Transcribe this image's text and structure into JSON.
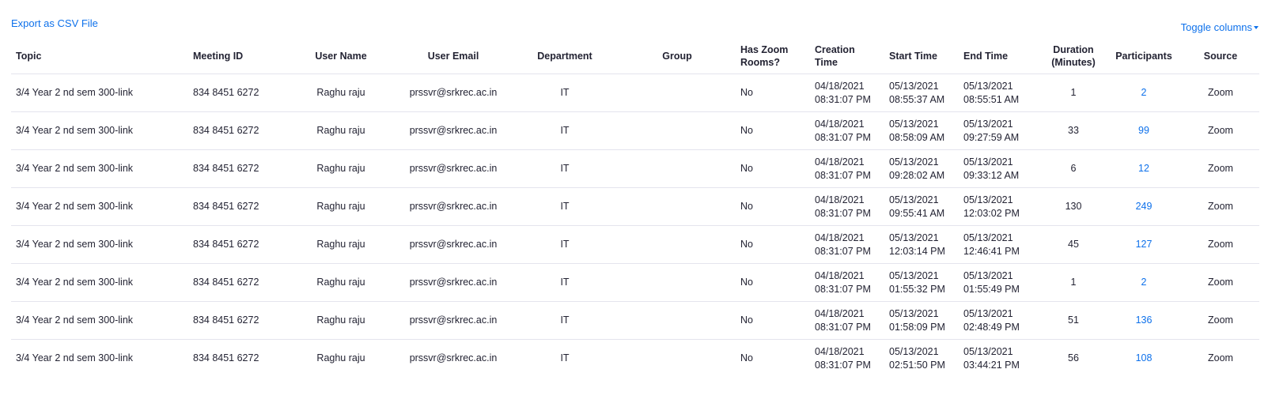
{
  "toolbar": {
    "export_label": "Export as CSV File",
    "toggle_columns_label": "Toggle columns"
  },
  "colors": {
    "link": "#0e71eb",
    "text": "#232333",
    "divider": "#e4e4ed"
  },
  "table": {
    "headers": {
      "topic": "Topic",
      "meeting_id": "Meeting ID",
      "user_name": "User Name",
      "user_email": "User Email",
      "department": "Department",
      "group": "Group",
      "has_zoom_rooms_1": "Has Zoom",
      "has_zoom_rooms_2": "Rooms?",
      "creation_time": "Creation Time",
      "start_time": "Start Time",
      "end_time": "End Time",
      "duration_1": "Duration",
      "duration_2": "(Minutes)",
      "participants": "Participants",
      "source": "Source"
    },
    "rows": [
      {
        "topic": "3/4 Year 2 nd sem 300-link",
        "meeting_id": "834 8451 6272",
        "user_name": "Raghu raju",
        "user_email": "prssvr@srkrec.ac.in",
        "department": "IT",
        "group": "",
        "has_zoom_rooms": "No",
        "creation_date": "04/18/2021",
        "creation_time": "08:31:07 PM",
        "start_date": "05/13/2021",
        "start_time": "08:55:37 AM",
        "end_date": "05/13/2021",
        "end_time": "08:55:51 AM",
        "duration": "1",
        "participants": "2",
        "source": "Zoom"
      },
      {
        "topic": "3/4 Year 2 nd sem 300-link",
        "meeting_id": "834 8451 6272",
        "user_name": "Raghu raju",
        "user_email": "prssvr@srkrec.ac.in",
        "department": "IT",
        "group": "",
        "has_zoom_rooms": "No",
        "creation_date": "04/18/2021",
        "creation_time": "08:31:07 PM",
        "start_date": "05/13/2021",
        "start_time": "08:58:09 AM",
        "end_date": "05/13/2021",
        "end_time": "09:27:59 AM",
        "duration": "33",
        "participants": "99",
        "source": "Zoom"
      },
      {
        "topic": "3/4 Year 2 nd sem 300-link",
        "meeting_id": "834 8451 6272",
        "user_name": "Raghu raju",
        "user_email": "prssvr@srkrec.ac.in",
        "department": "IT",
        "group": "",
        "has_zoom_rooms": "No",
        "creation_date": "04/18/2021",
        "creation_time": "08:31:07 PM",
        "start_date": "05/13/2021",
        "start_time": "09:28:02 AM",
        "end_date": "05/13/2021",
        "end_time": "09:33:12 AM",
        "duration": "6",
        "participants": "12",
        "source": "Zoom"
      },
      {
        "topic": "3/4 Year 2 nd sem 300-link",
        "meeting_id": "834 8451 6272",
        "user_name": "Raghu raju",
        "user_email": "prssvr@srkrec.ac.in",
        "department": "IT",
        "group": "",
        "has_zoom_rooms": "No",
        "creation_date": "04/18/2021",
        "creation_time": "08:31:07 PM",
        "start_date": "05/13/2021",
        "start_time": "09:55:41 AM",
        "end_date": "05/13/2021",
        "end_time": "12:03:02 PM",
        "duration": "130",
        "participants": "249",
        "source": "Zoom"
      },
      {
        "topic": "3/4 Year 2 nd sem 300-link",
        "meeting_id": "834 8451 6272",
        "user_name": "Raghu raju",
        "user_email": "prssvr@srkrec.ac.in",
        "department": "IT",
        "group": "",
        "has_zoom_rooms": "No",
        "creation_date": "04/18/2021",
        "creation_time": "08:31:07 PM",
        "start_date": "05/13/2021",
        "start_time": "12:03:14 PM",
        "end_date": "05/13/2021",
        "end_time": "12:46:41 PM",
        "duration": "45",
        "participants": "127",
        "source": "Zoom"
      },
      {
        "topic": "3/4 Year 2 nd sem 300-link",
        "meeting_id": "834 8451 6272",
        "user_name": "Raghu raju",
        "user_email": "prssvr@srkrec.ac.in",
        "department": "IT",
        "group": "",
        "has_zoom_rooms": "No",
        "creation_date": "04/18/2021",
        "creation_time": "08:31:07 PM",
        "start_date": "05/13/2021",
        "start_time": "01:55:32 PM",
        "end_date": "05/13/2021",
        "end_time": "01:55:49 PM",
        "duration": "1",
        "participants": "2",
        "source": "Zoom"
      },
      {
        "topic": "3/4 Year 2 nd sem 300-link",
        "meeting_id": "834 8451 6272",
        "user_name": "Raghu raju",
        "user_email": "prssvr@srkrec.ac.in",
        "department": "IT",
        "group": "",
        "has_zoom_rooms": "No",
        "creation_date": "04/18/2021",
        "creation_time": "08:31:07 PM",
        "start_date": "05/13/2021",
        "start_time": "01:58:09 PM",
        "end_date": "05/13/2021",
        "end_time": "02:48:49 PM",
        "duration": "51",
        "participants": "136",
        "source": "Zoom"
      },
      {
        "topic": "3/4 Year 2 nd sem 300-link",
        "meeting_id": "834 8451 6272",
        "user_name": "Raghu raju",
        "user_email": "prssvr@srkrec.ac.in",
        "department": "IT",
        "group": "",
        "has_zoom_rooms": "No",
        "creation_date": "04/18/2021",
        "creation_time": "08:31:07 PM",
        "start_date": "05/13/2021",
        "start_time": "02:51:50 PM",
        "end_date": "05/13/2021",
        "end_time": "03:44:21 PM",
        "duration": "56",
        "participants": "108",
        "source": "Zoom"
      }
    ]
  }
}
